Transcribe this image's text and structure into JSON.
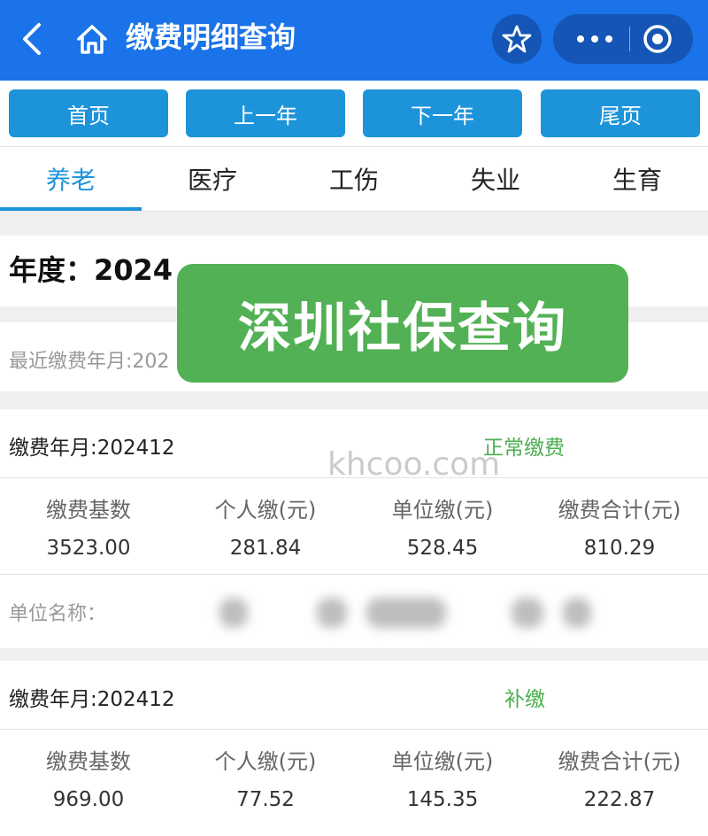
{
  "header": {
    "title": "缴费明细查询",
    "icons": {
      "back": "back-chevron-icon",
      "home": "home-icon",
      "favorite": "star-icon",
      "more": "more-dots-icon",
      "close": "target-circle-icon"
    }
  },
  "nav_buttons": [
    "首页",
    "上一年",
    "下一年",
    "尾页"
  ],
  "tabs": [
    "养老",
    "医疗",
    "工伤",
    "失业",
    "生育"
  ],
  "active_tab": "养老",
  "year_label": "年度：2024",
  "latest_label": "最近缴费年月:202",
  "overlay_text": "深圳社保查询",
  "watermark": "khcoo.com",
  "unit_label": "单位名称：",
  "records": [
    {
      "month": "缴费年月:202412",
      "status": "正常缴费",
      "headers": [
        "缴费基数",
        "个人缴(元)",
        "单位缴(元)",
        "缴费合计(元)"
      ],
      "values": [
        "3523.00",
        "281.84",
        "528.45",
        "810.29"
      ]
    },
    {
      "month": "缴费年月:202412",
      "status": "补缴",
      "headers": [
        "缴费基数",
        "个人缴(元)",
        "单位缴(元)",
        "缴费合计(元)"
      ],
      "values": [
        "969.00",
        "77.52",
        "145.35",
        "222.87"
      ]
    }
  ],
  "colors": {
    "header_bg": "#1a73e8",
    "button_bg": "#1d94da",
    "status_green": "#4caf50",
    "overlay_green": "#52b154"
  }
}
